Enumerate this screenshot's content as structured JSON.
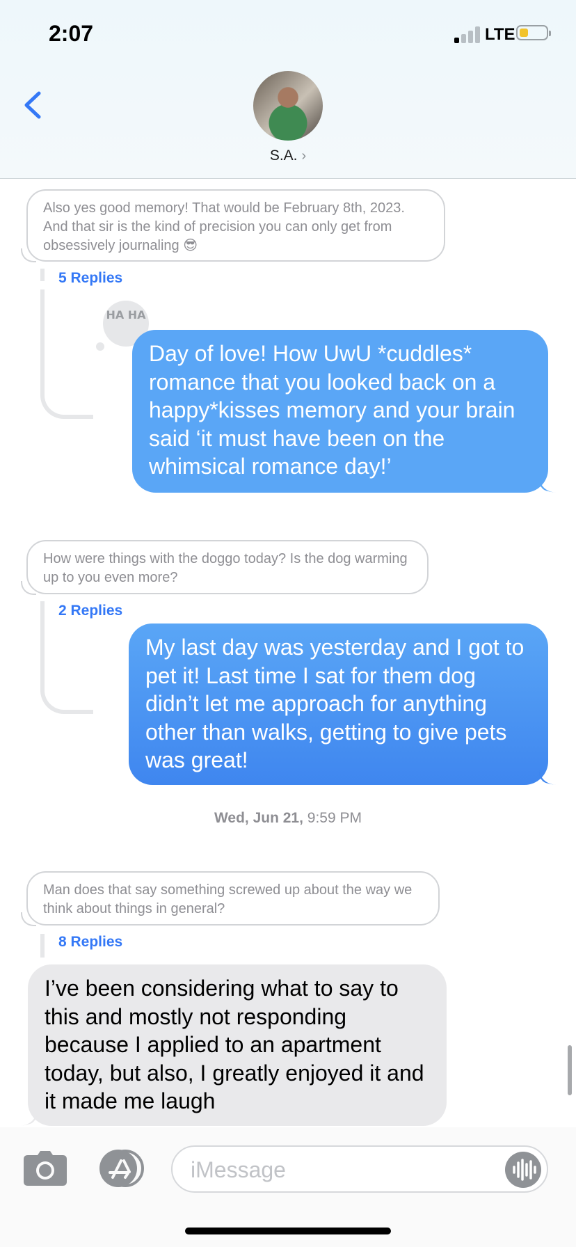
{
  "status_bar": {
    "time": "2:07",
    "network": "LTE"
  },
  "header": {
    "contact_name": "S.A.",
    "chevron": "›"
  },
  "thread1": {
    "quote": "Also yes good memory! That would be February 8th, 2023. And that sir is the kind of precision you can only get from obsessively journaling 😎",
    "replies": "5 Replies",
    "tapback": "HA HA",
    "sent": "Day of love! How UwU *cuddles* romance that you looked back on a happy*kisses memory and your brain said ‘it must have been on the whimsical romance day!’"
  },
  "thread2": {
    "quote": "How were things with the doggo today? Is the dog warming up to you even more?",
    "replies": "2 Replies",
    "sent": "My last day was yesterday and I got to pet it! Last time I sat for them dog didn’t let me approach for anything other than walks, getting to give pets was great!"
  },
  "timestamp": {
    "day": "Wed, Jun 21,",
    "time": "9:59 PM"
  },
  "thread3": {
    "quote": "Man does that say something screwed up about the way we think about things in general?",
    "replies": "8 Replies",
    "received": "I’ve been considering what to say to this and mostly not responding because I applied to an apartment today, but also, I greatly enjoyed it and it made me laugh"
  },
  "compose": {
    "placeholder": "iMessage"
  },
  "colors": {
    "accent": "#3478f6",
    "sent_top": "#5aa6f6",
    "sent_bottom": "#3f86ef",
    "received": "#e9e9eb"
  },
  "icons": [
    "back-chevron-icon",
    "camera-icon",
    "app-store-icon",
    "audio-waveform-icon"
  ]
}
